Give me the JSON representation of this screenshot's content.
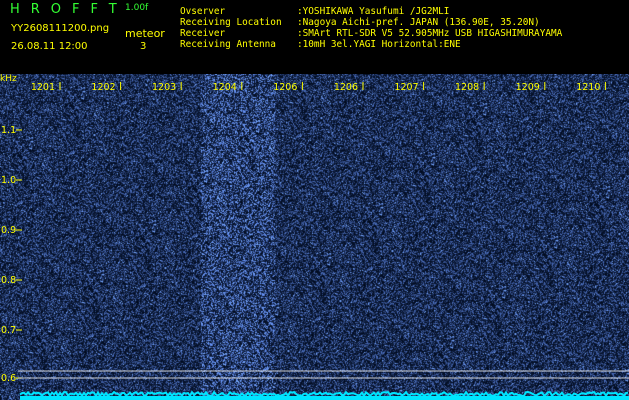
{
  "header": {
    "brand": "HROFFT",
    "version": "1.00f",
    "filename": "YY2608111200.png",
    "datetime": "26.08.11 12:00",
    "type_label": "meteor",
    "count": "3",
    "info": [
      {
        "key": "Ovserver",
        "value": ":YOSHIKAWA Yasufumi /JG2MLI"
      },
      {
        "key": "Receiving Location",
        "value": ":Nagoya Aichi-pref. JAPAN (136.90E, 35.20N)"
      },
      {
        "key": "Receiver",
        "value": ":SMArt RTL-SDR V5 52.905MHz USB HIGASHIMURAYAMA"
      },
      {
        "key": "Receiving Antenna",
        "value": ":10mH 3el.YAGI Horizontal:ENE"
      }
    ]
  },
  "spectrogram": {
    "y_axis_unit": "kHz",
    "x_tick_labels": [
      "1201",
      "1202",
      "1203",
      "1204",
      "1206",
      "1206",
      "1207",
      "1208",
      "1209",
      "1210"
    ],
    "y_tick_labels": [
      "1.1",
      "1.0",
      "0.9",
      "0.8",
      "0.7",
      "0.6"
    ],
    "colors": {
      "background": "#00001a",
      "noise": "#1a3aff",
      "grid": "#ffff00",
      "baseline": "#00e5ff",
      "label": "#ffff00"
    }
  }
}
